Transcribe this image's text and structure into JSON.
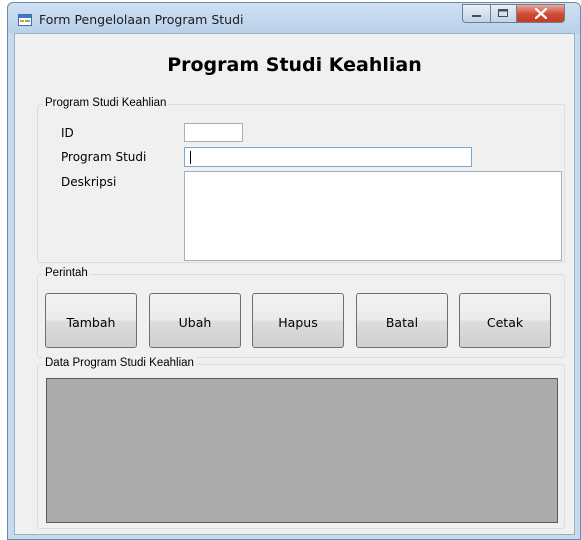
{
  "window": {
    "title": "Form Pengelolaan Program Studi"
  },
  "form": {
    "heading": "Program Studi Keahlian",
    "group_info": {
      "legend": "Program Studi Keahlian",
      "id_label": "ID",
      "id_value": "",
      "program_label": "Program Studi",
      "program_value": "",
      "desc_label": "Deskripsi",
      "desc_value": ""
    },
    "group_commands": {
      "legend": "Perintah",
      "buttons": [
        "Tambah",
        "Ubah",
        "Hapus",
        "Batal",
        "Cetak"
      ]
    },
    "group_data": {
      "legend": "Data Program Studi Keahlian"
    }
  },
  "colors": {
    "titlebar": "#b9d1ea",
    "close_button": "#c94a34",
    "grid_background": "#ababab"
  }
}
